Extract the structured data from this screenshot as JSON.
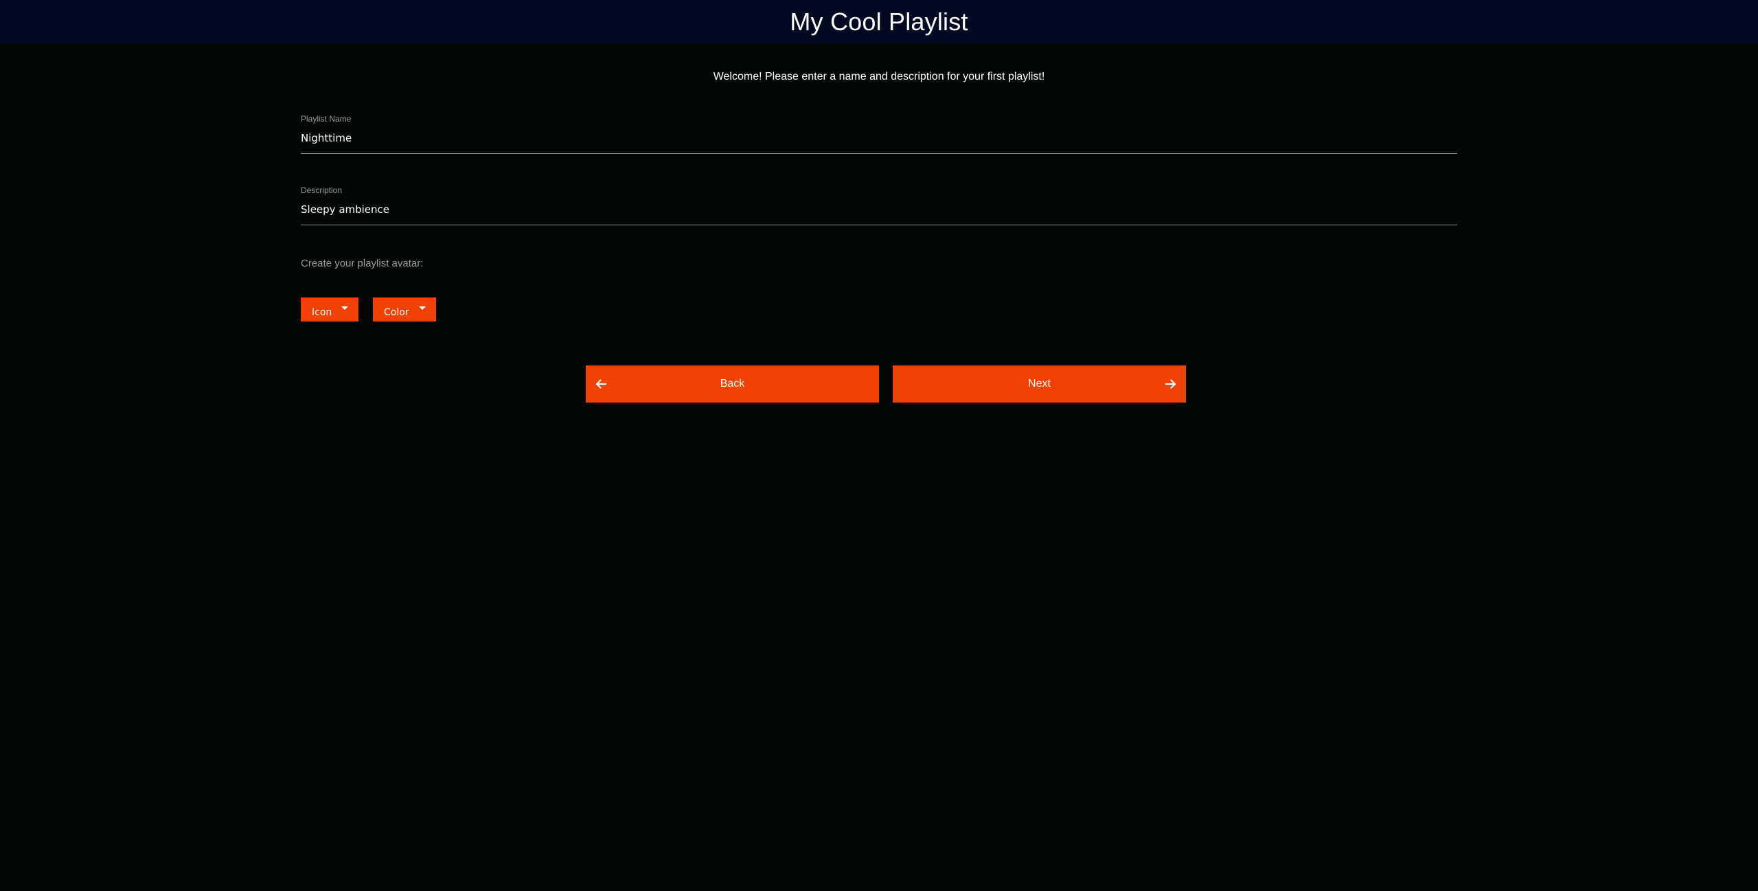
{
  "header": {
    "title": "My Cool Playlist"
  },
  "welcome_text": "Welcome! Please enter a name and description for your first playlist!",
  "form": {
    "name_field": {
      "label": "Playlist Name",
      "value": "Nighttime"
    },
    "description_field": {
      "label": "Description",
      "value": "Sleepy ambience"
    }
  },
  "avatar": {
    "label": "Create your playlist avatar:",
    "icon_button": "Icon",
    "color_button": "Color"
  },
  "navigation": {
    "back_label": "Back",
    "next_label": "Next",
    "back_icon": "arrow-left-icon",
    "next_icon": "arrow-right-icon"
  },
  "colors": {
    "accent": "#f04107",
    "header_bg": "#020a23",
    "page_bg": "#020605"
  }
}
